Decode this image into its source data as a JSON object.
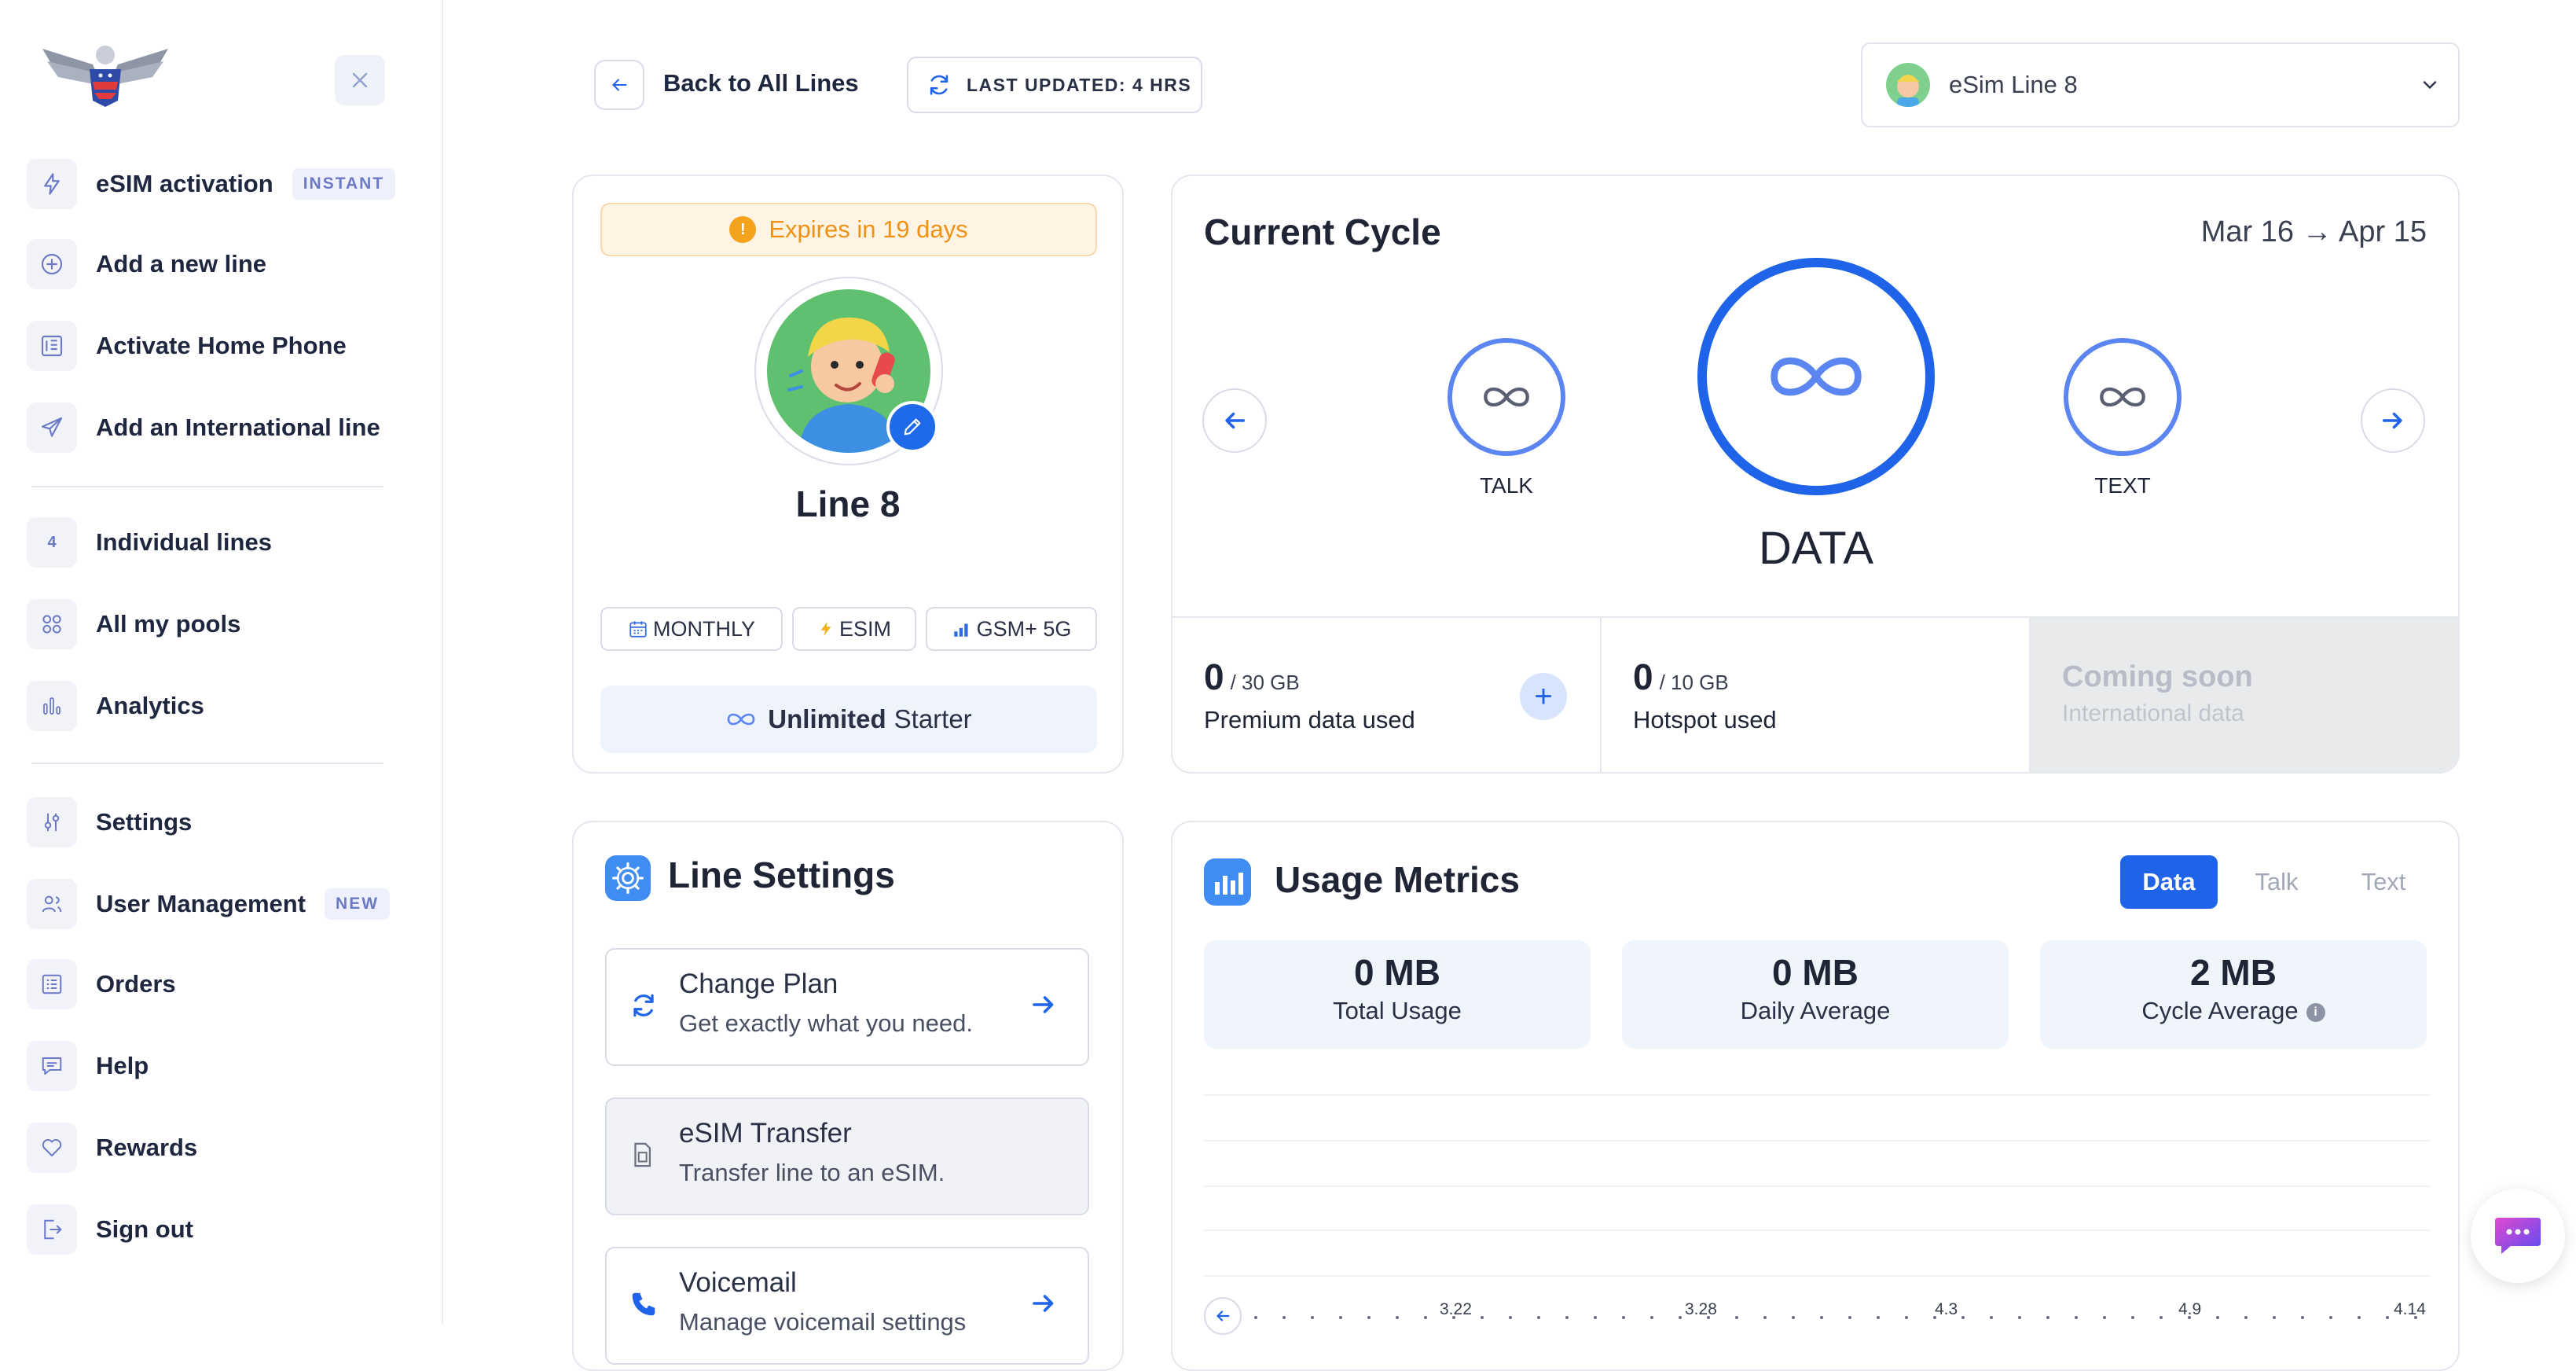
{
  "sidebar": {
    "items": [
      {
        "label": "eSIM activation",
        "badge": "INSTANT",
        "icon": "bolt-icon"
      },
      {
        "label": "Add a new line",
        "icon": "plus-circle-icon"
      },
      {
        "label": "Activate Home Phone",
        "icon": "phone-keypad-icon"
      },
      {
        "label": "Add an International line",
        "icon": "plane-icon"
      },
      {
        "label": "Individual lines",
        "icon_text": "4"
      },
      {
        "label": "All my pools",
        "icon": "pools-icon"
      },
      {
        "label": "Analytics",
        "icon": "bar-chart-icon"
      },
      {
        "label": "Settings",
        "icon": "sliders-icon"
      },
      {
        "label": "User Management",
        "badge": "NEW",
        "icon": "users-icon"
      },
      {
        "label": "Orders",
        "icon": "list-icon"
      },
      {
        "label": "Help",
        "icon": "chat-icon"
      },
      {
        "label": "Rewards",
        "icon": "heart-icon"
      },
      {
        "label": "Sign out",
        "icon": "sign-out-icon"
      }
    ]
  },
  "topbar": {
    "back_label": "Back to All Lines",
    "updated_label": "LAST UPDATED: 4 HRS",
    "line_select": "eSim Line 8"
  },
  "profile": {
    "expires": "Expires in 19 days",
    "name": "Line 8",
    "chips": [
      "MONTHLY",
      "ESIM",
      "GSM+ 5G"
    ],
    "plan_bold": "Unlimited",
    "plan_rest": "Starter"
  },
  "cycle": {
    "title": "Current Cycle",
    "dates": "Mar 16 → Apr 15",
    "talk_label": "TALK",
    "data_label": "DATA",
    "text_label": "TEXT",
    "stats": [
      {
        "value": "0",
        "unit": "/ 30 GB",
        "label": "Premium data used"
      },
      {
        "value": "0",
        "unit": "/ 10 GB",
        "label": "Hotspot used"
      },
      {
        "value": "Coming soon",
        "label": "International data"
      }
    ]
  },
  "line_settings": {
    "title": "Line Settings",
    "items": [
      {
        "title": "Change Plan",
        "subtitle": "Get exactly what you need."
      },
      {
        "title": "eSIM Transfer",
        "subtitle": "Transfer line to an eSIM."
      },
      {
        "title": "Voicemail",
        "subtitle": "Manage voicemail settings"
      }
    ]
  },
  "usage": {
    "title": "Usage Metrics",
    "tabs": [
      "Data",
      "Talk",
      "Text"
    ],
    "active_tab": "Data",
    "metrics": [
      {
        "value": "0 MB",
        "label": "Total Usage"
      },
      {
        "value": "0 MB",
        "label": "Daily Average"
      },
      {
        "value": "2 MB",
        "label": "Cycle Average"
      }
    ],
    "axis_ticks": [
      "3.22",
      "3.28",
      "4.3",
      "4.9",
      "4.14"
    ]
  },
  "colors": {
    "accent": "#1f63e8",
    "warning": "#ef9214",
    "badge_text": "#6c79c6"
  }
}
